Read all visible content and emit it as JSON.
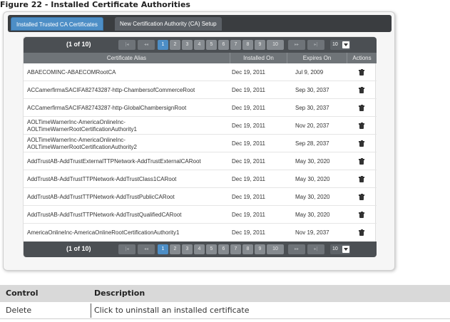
{
  "figure_caption": "Figure 22 - Installed Certificate Authorities",
  "tabs": [
    {
      "label": "Installed Trusted CA Certificates",
      "active": true
    },
    {
      "label": "New Certification Authority (CA) Setup",
      "active": false
    }
  ],
  "pager": {
    "count_text": "(1 of 10)",
    "first_icon": "first-page-icon",
    "prev_icon": "previous-page-icon",
    "next_icon": "next-page-icon",
    "last_icon": "last-page-icon",
    "first_glyph": "|◂",
    "prev_glyph": "◂◂",
    "next_glyph": "▸▸",
    "last_glyph": "▸|",
    "pages": [
      "1",
      "2",
      "3",
      "4",
      "5",
      "6",
      "7",
      "8",
      "9",
      "10"
    ],
    "current_page": "1",
    "rows_per_page": "10"
  },
  "table": {
    "headers": [
      "Certificate Alias",
      "Installed On",
      "Expires On",
      "Actions"
    ],
    "rows": [
      {
        "alias": "ABAECOMINC-ABAECOMRootCA",
        "installed": "Dec 19, 2011",
        "expires": "Jul 9, 2009",
        "action_icon": "trash-icon"
      },
      {
        "alias": "ACCamerfirmaSACIFA82743287-http-ChambersofCommerceRoot",
        "installed": "Dec 19, 2011",
        "expires": "Sep 30, 2037",
        "action_icon": "trash-icon"
      },
      {
        "alias": "ACCamerfirmaSACIFA82743287-http-GlobalChambersignRoot",
        "installed": "Dec 19, 2011",
        "expires": "Sep 30, 2037",
        "action_icon": "trash-icon"
      },
      {
        "alias": "AOLTimeWarnerInc-AmericaOnlineInc-AOLTimeWarnerRootCertificationAuthority1",
        "alias_line1": "AOLTimeWarnerInc-AmericaOnlineInc-",
        "alias_line2": "AOLTimeWarnerRootCertificationAuthority1",
        "installed": "Dec 19, 2011",
        "expires": "Nov 20, 2037",
        "action_icon": "trash-icon"
      },
      {
        "alias": "AOLTimeWarnerInc-AmericaOnlineInc-AOLTimeWarnerRootCertificationAuthority2",
        "alias_line1": "AOLTimeWarnerInc-AmericaOnlineInc-",
        "alias_line2": "AOLTimeWarnerRootCertificationAuthority2",
        "installed": "Dec 19, 2011",
        "expires": "Sep 28, 2037",
        "action_icon": "trash-icon"
      },
      {
        "alias": "AddTrustAB-AddTrustExternalTTPNetwork-AddTrustExternalCARoot",
        "installed": "Dec 19, 2011",
        "expires": "May 30, 2020",
        "action_icon": "trash-icon"
      },
      {
        "alias": "AddTrustAB-AddTrustTTPNetwork-AddTrustClass1CARoot",
        "installed": "Dec 19, 2011",
        "expires": "May 30, 2020",
        "action_icon": "trash-icon"
      },
      {
        "alias": "AddTrustAB-AddTrustTTPNetwork-AddTrustPublicCARoot",
        "installed": "Dec 19, 2011",
        "expires": "May 30, 2020",
        "action_icon": "trash-icon"
      },
      {
        "alias": "AddTrustAB-AddTrustTTPNetwork-AddTrustQualifiedCARoot",
        "installed": "Dec 19, 2011",
        "expires": "May 30, 2020",
        "action_icon": "trash-icon"
      },
      {
        "alias": "AmericaOnlineInc-AmericaOnlineRootCertificationAuthority1",
        "installed": "Dec 19, 2011",
        "expires": "Nov 19, 2037",
        "action_icon": "trash-icon"
      }
    ]
  },
  "control_table": {
    "headers": [
      "Control",
      "Description"
    ],
    "rows": [
      {
        "control": "Delete",
        "description": "Click to uninstall an installed certificate"
      }
    ]
  },
  "colors": {
    "accent": "#4d8ec6",
    "tabbar": "#3a3d40",
    "pager": "#4b4f53",
    "header": "#6f7478"
  }
}
